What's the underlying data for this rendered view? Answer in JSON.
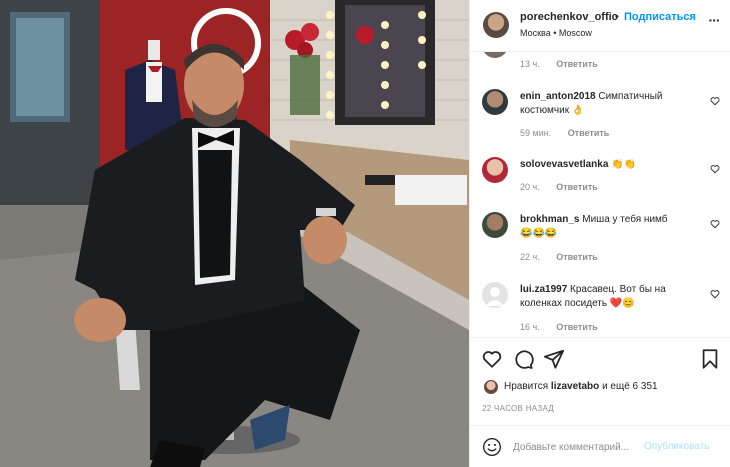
{
  "post": {
    "username": "porechenkov_offic",
    "dot": "•",
    "follow_label": "Подписаться",
    "location": "Москва • Moscow",
    "more_label": "···"
  },
  "comments": {
    "partial_meta": {
      "time": "13 ч.",
      "reply": "Ответить"
    },
    "items": [
      {
        "user": "enin_anton2018",
        "text": "Симпатичный",
        "text2": "костюмчик 👌",
        "time": "59 мин.",
        "reply": "Ответить"
      },
      {
        "user": "solovevasvetlanka",
        "text": "👏👏",
        "time": "20 ч.",
        "reply": "Ответить"
      },
      {
        "user": "brokhman_s",
        "text": "Миша у тебя нимб",
        "text2": "😂😂😂",
        "time": "22 ч.",
        "reply": "Ответить"
      },
      {
        "user": "lui.za1997",
        "text": "Красавец. Вот бы на",
        "text2": "коленках посидеть ❤️😊",
        "time": "16 ч.",
        "reply": "Ответить"
      }
    ]
  },
  "likes": {
    "prefix": "Нравится",
    "user": "lizavetabo",
    "suffix": "и ещё 6 351"
  },
  "time_ago": "22 ЧАСОВ НАЗАД",
  "add_comment": {
    "placeholder": "Добавьте комментарий...",
    "publish_label": "Опубликовать"
  },
  "icons": {
    "more": "more-icon",
    "like": "heart-icon",
    "comment": "comment-icon",
    "share": "share-icon",
    "save": "bookmark-icon",
    "emoji": "smiley-icon"
  },
  "colors": {
    "accent": "#0095f6",
    "publish_disabled": "#b2dffc",
    "text": "#262626",
    "muted": "#8e8e8e"
  }
}
